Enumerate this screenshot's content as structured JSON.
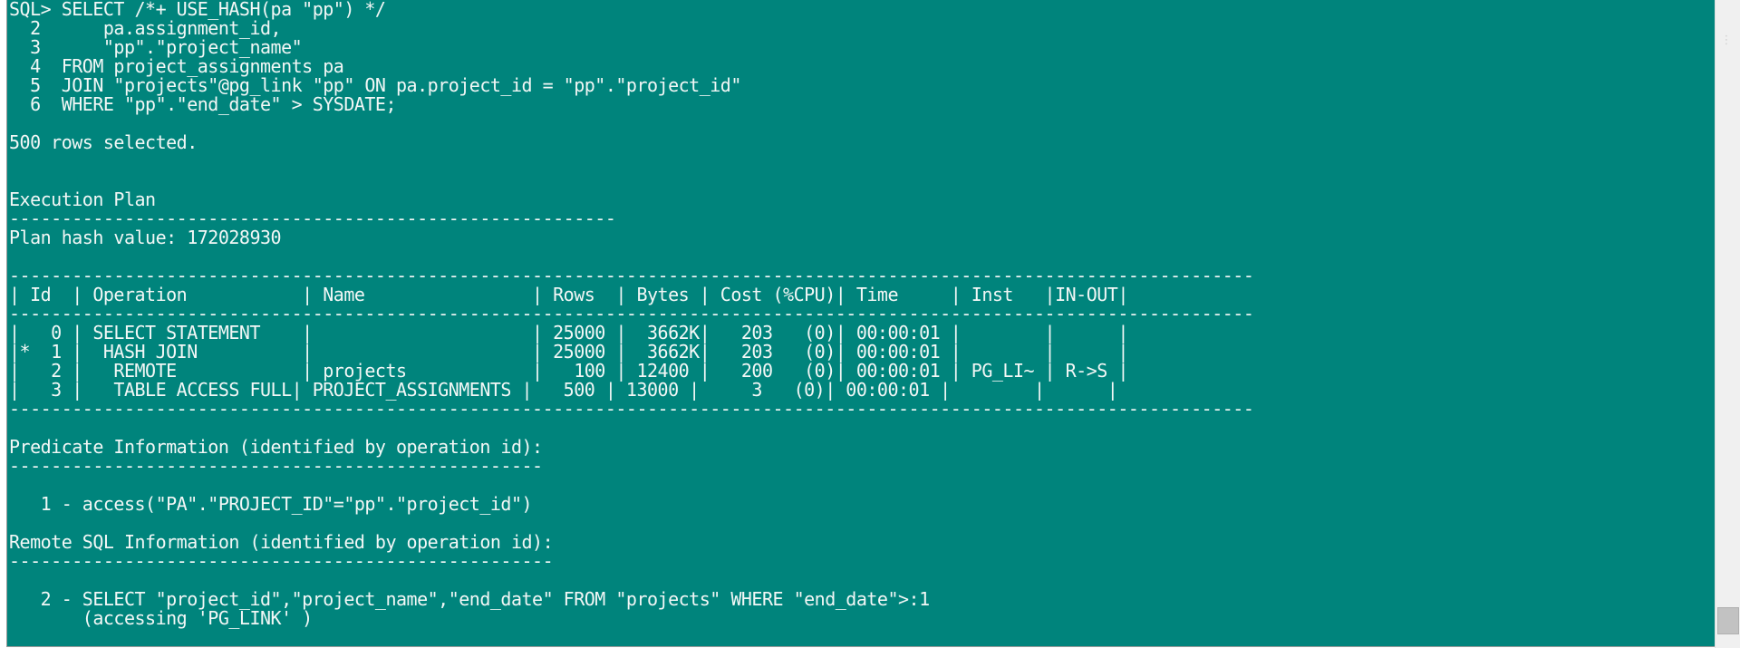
{
  "console": {
    "lines": [
      "SQL> SELECT /*+ USE_HASH(pa \"pp\") */",
      "  2      pa.assignment_id,",
      "  3      \"pp\".\"project_name\"",
      "  4  FROM project_assignments pa",
      "  5  JOIN \"projects\"@pg_link \"pp\" ON pa.project_id = \"pp\".\"project_id\"",
      "  6  WHERE \"pp\".\"end_date\" > SYSDATE;",
      "",
      "500 rows selected.",
      "",
      "",
      "Execution Plan",
      "----------------------------------------------------------",
      "Plan hash value: 172028930",
      "",
      "-----------------------------------------------------------------------------------------------------------------------",
      "| Id  | Operation           | Name                | Rows  | Bytes | Cost (%CPU)| Time     | Inst   |IN-OUT|",
      "-----------------------------------------------------------------------------------------------------------------------",
      "|   0 | SELECT STATEMENT    |                     | 25000 |  3662K|   203   (0)| 00:00:01 |        |      |",
      "|*  1 |  HASH JOIN          |                     | 25000 |  3662K|   203   (0)| 00:00:01 |        |      |",
      "|   2 |   REMOTE            | projects            |   100 | 12400 |   200   (0)| 00:00:01 | PG_LI~ | R->S |",
      "|   3 |   TABLE ACCESS FULL| PROJECT_ASSIGNMENTS |   500 | 13000 |     3   (0)| 00:00:01 |        |      |",
      "-----------------------------------------------------------------------------------------------------------------------",
      "",
      "Predicate Information (identified by operation id):",
      "---------------------------------------------------",
      "",
      "   1 - access(\"PA\".\"PROJECT_ID\"=\"pp\".\"project_id\")",
      "",
      "Remote SQL Information (identified by operation id):",
      "----------------------------------------------------",
      "",
      "   2 - SELECT \"project_id\",\"project_name\",\"end_date\" FROM \"projects\" WHERE \"end_date\">:1",
      "       (accessing 'PG_LINK' )"
    ]
  },
  "scrollbar": {
    "thumb_icon": "scrollbar-thumb",
    "corner_icon": "resize-icon"
  },
  "colors": {
    "console_background": "#00847c",
    "console_text": "#f2f7f6",
    "scrollbar_background": "#f0f0f0"
  }
}
